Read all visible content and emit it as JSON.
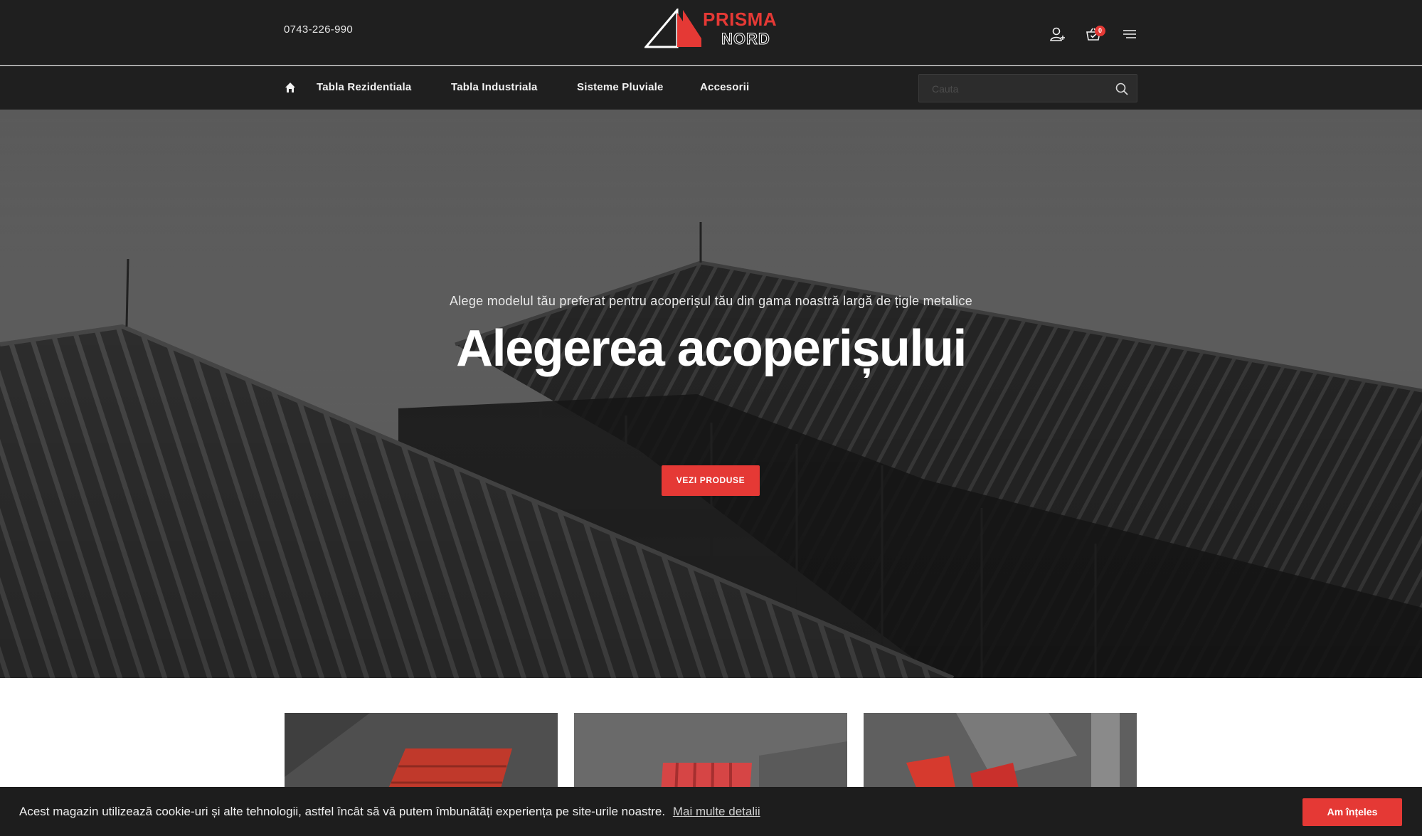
{
  "header": {
    "phone": "0743-226-990",
    "logo": {
      "line1": "PRISMA",
      "line2": "NORD"
    },
    "cart_count": "0",
    "icons": [
      "user-add-icon",
      "cart-icon",
      "menu-icon"
    ]
  },
  "nav": {
    "home_icon": "home-icon",
    "items": [
      {
        "label": "Tabla Rezidentiala"
      },
      {
        "label": "Tabla Industriala"
      },
      {
        "label": "Sisteme Pluviale"
      },
      {
        "label": "Accesorii"
      }
    ],
    "search": {
      "placeholder": "Cauta",
      "icon": "search-icon"
    }
  },
  "hero": {
    "subtitle": "Alege modelul tău preferat pentru acoperișul tău din gama noastră largă de țigle metalice",
    "title": "Alegerea acoperișului",
    "button": "VEZI PRODUSE"
  },
  "cookie": {
    "text": "Acest magazin utilizează cookie-uri și alte tehnologii, astfel încât să vă putem îmbunătăți experiența pe site-urile noastre.",
    "link": "Mai multe detalii",
    "button": "Am înțeles"
  },
  "colors": {
    "accent": "#e53935",
    "header_bg": "#1f1f1f",
    "cookie_bg": "#1d1d1d"
  }
}
